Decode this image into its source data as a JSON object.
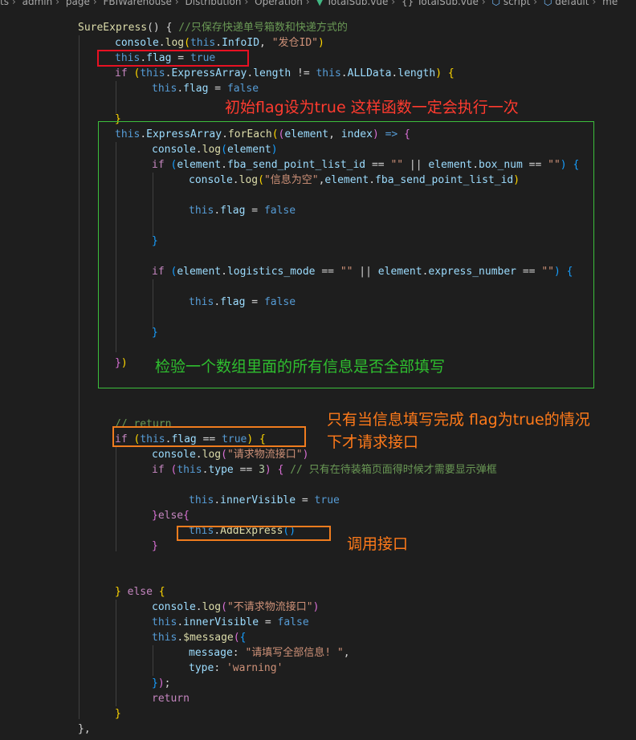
{
  "breadcrumb": {
    "items": [
      "ts",
      "admin",
      "page",
      "FBIWarehouse",
      "Distribution",
      "Operation"
    ],
    "file1": "TotalSub.vue",
    "braces": "{}",
    "file2": "TotalSub.vue",
    "script": "script",
    "default_item": "default",
    "last": "me"
  },
  "code": {
    "l1_name": "SureExpress",
    "l1_paren": "() {",
    "l1_comment": "//只保存快递单号箱数和快递方式的",
    "console": "console",
    "log": "log",
    "this": "this",
    "InfoID": "InfoID",
    "str_cang": "\"发仓ID\"",
    "flag": "flag",
    "true_kw": "true",
    "false_kw": "false",
    "if_kw": "if",
    "else_kw": "else",
    "return_kw": "return",
    "ExpressArray": "ExpressArray",
    "length": "length",
    "ALLData": "ALLData",
    "forEach": "forEach",
    "element": "element",
    "index": "index",
    "fba": "fba_send_point_list_id",
    "box_num": "box_num",
    "empty_str": "\"\"",
    "str_empty_info": "\"信息为空\"",
    "logistics_mode": "logistics_mode",
    "express_number": "express_number",
    "return_comment": "// return",
    "str_request": "\"请求物流接口\"",
    "type": "type",
    "three": "3",
    "type_comment": "// 只有在待装箱页面得时候才需要显示弹框",
    "innerVisible": "innerVisible",
    "AddExpress": "AddExpress",
    "str_no_request": "\"不请求物流接口\"",
    "message_fn": "$message",
    "message_key": "message",
    "str_fill": "\"请填写全部信息! \"",
    "type_key": "type",
    "str_warning": "'warning'"
  },
  "annotations": {
    "red": "初始flag设为true  这样函数一定会执行一次",
    "green": "检验一个数组里面的所有信息是否全部填写",
    "orange_line1": "只有当信息填写完成 flag为true的情况",
    "orange_line2": "下才请求接口",
    "orange_call": "调用接口"
  },
  "colors": {
    "background": "#1e1e1e",
    "red_box": "#e81123",
    "green_box": "#3cbf3c",
    "orange_box": "#f07c1e"
  }
}
